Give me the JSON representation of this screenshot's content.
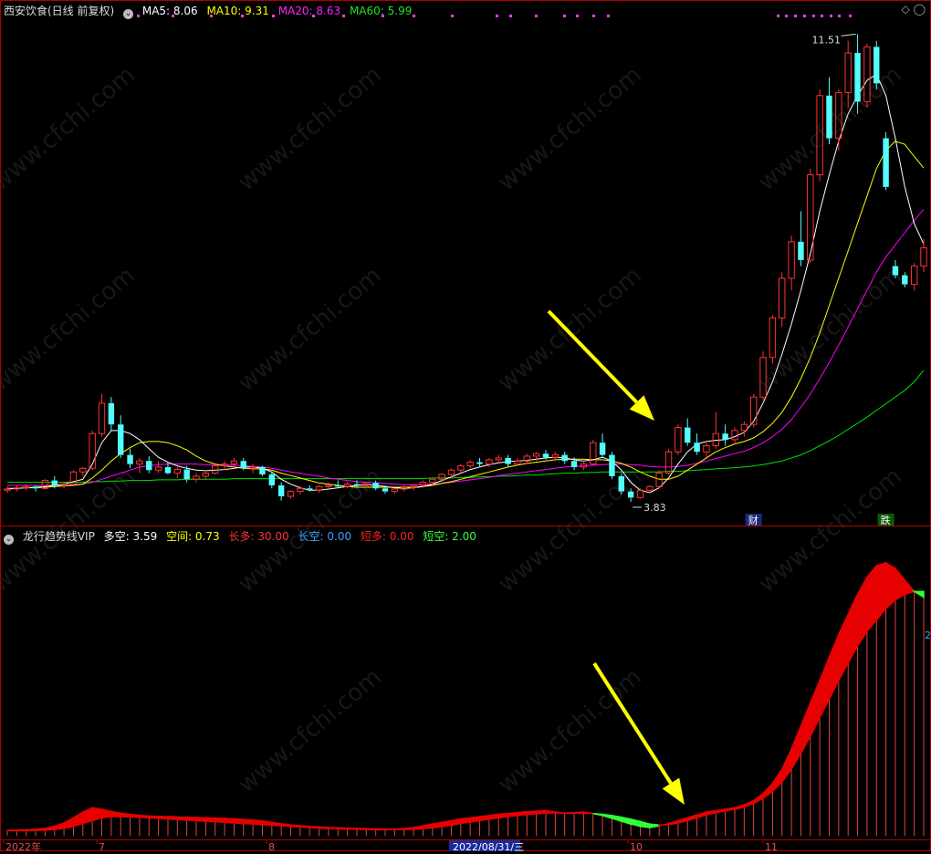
{
  "colors": {
    "up": "#ff3232",
    "down": "#54fcfc",
    "ma5": "#ffffff",
    "ma10": "#ffff00",
    "ma20": "#ff00ff",
    "ma60": "#00e000",
    "bull": "#e60000",
    "bear": "#33ff33",
    "arrow": "#ffff00"
  },
  "top_header": {
    "title": "西安饮食(日线 前复权)",
    "ma5": "MA5: 8.06",
    "ma10": "MA10: 9.31",
    "ma20": "MA20: 8.63",
    "ma60": "MA60: 5.99"
  },
  "bottom_header": {
    "title": "龙行趋势线VIP",
    "duokong": "多空: 3.59",
    "kongjian": "空间: 0.73",
    "changduo": "长多: 30.00",
    "changkong": "长空: 0.00",
    "duanduo": "短多: 0.00",
    "duankong": "短空: 2.00"
  },
  "annotations": {
    "high_label": "11.51",
    "low_label": "3.83",
    "cai_badge": "财",
    "die_badge": "跌",
    "side_value": "2"
  },
  "watermark": "www.cfchi.com",
  "x_axis": {
    "labels": [
      "2022年",
      "7",
      "8",
      "2022/08/31/三",
      "10",
      "11"
    ]
  },
  "chart_data": {
    "type": "candlestick",
    "title": "西安饮食(日线 前复权)",
    "y_range": [
      3.5,
      11.8
    ],
    "candles": [
      [
        4.02,
        4.08,
        3.98,
        4.04
      ],
      [
        4.04,
        4.1,
        4.0,
        4.06
      ],
      [
        4.06,
        4.12,
        4.02,
        4.08
      ],
      [
        4.08,
        4.1,
        4.0,
        4.05
      ],
      [
        4.05,
        4.2,
        4.03,
        4.18
      ],
      [
        4.18,
        4.25,
        4.05,
        4.1
      ],
      [
        4.1,
        4.16,
        4.05,
        4.12
      ],
      [
        4.12,
        4.35,
        4.1,
        4.32
      ],
      [
        4.32,
        4.4,
        4.25,
        4.38
      ],
      [
        4.38,
        5.0,
        4.35,
        4.95
      ],
      [
        4.95,
        5.6,
        4.9,
        5.45
      ],
      [
        5.45,
        5.55,
        5.0,
        5.1
      ],
      [
        5.1,
        5.25,
        4.55,
        4.6
      ],
      [
        4.6,
        4.7,
        4.38,
        4.45
      ],
      [
        4.45,
        4.55,
        4.3,
        4.5
      ],
      [
        4.5,
        4.58,
        4.3,
        4.35
      ],
      [
        4.35,
        4.5,
        4.3,
        4.4
      ],
      [
        4.4,
        4.48,
        4.28,
        4.3
      ],
      [
        4.3,
        4.4,
        4.22,
        4.36
      ],
      [
        4.36,
        4.42,
        4.15,
        4.2
      ],
      [
        4.2,
        4.3,
        4.15,
        4.25
      ],
      [
        4.25,
        4.35,
        4.2,
        4.3
      ],
      [
        4.3,
        4.45,
        4.28,
        4.42
      ],
      [
        4.42,
        4.5,
        4.35,
        4.45
      ],
      [
        4.45,
        4.55,
        4.38,
        4.5
      ],
      [
        4.5,
        4.55,
        4.35,
        4.38
      ],
      [
        4.38,
        4.45,
        4.3,
        4.4
      ],
      [
        4.4,
        4.42,
        4.25,
        4.28
      ],
      [
        4.28,
        4.32,
        4.05,
        4.1
      ],
      [
        4.1,
        4.15,
        3.85,
        3.92
      ],
      [
        3.92,
        4.02,
        3.88,
        4.0
      ],
      [
        4.0,
        4.08,
        3.95,
        4.05
      ],
      [
        4.05,
        4.1,
        4.0,
        4.02
      ],
      [
        4.02,
        4.1,
        3.98,
        4.08
      ],
      [
        4.08,
        4.15,
        4.04,
        4.1
      ],
      [
        4.1,
        4.18,
        4.05,
        4.08
      ],
      [
        4.08,
        4.16,
        4.05,
        4.12
      ],
      [
        4.12,
        4.18,
        4.06,
        4.1
      ],
      [
        4.1,
        4.16,
        4.05,
        4.14
      ],
      [
        4.14,
        4.18,
        4.02,
        4.05
      ],
      [
        4.05,
        4.1,
        3.96,
        4.0
      ],
      [
        4.0,
        4.06,
        3.96,
        4.04
      ],
      [
        4.04,
        4.1,
        4.0,
        4.06
      ],
      [
        4.06,
        4.12,
        4.02,
        4.1
      ],
      [
        4.1,
        4.18,
        4.06,
        4.15
      ],
      [
        4.15,
        4.22,
        4.1,
        4.2
      ],
      [
        4.2,
        4.3,
        4.15,
        4.28
      ],
      [
        4.28,
        4.38,
        4.22,
        4.35
      ],
      [
        4.35,
        4.45,
        4.3,
        4.42
      ],
      [
        4.42,
        4.52,
        4.38,
        4.48
      ],
      [
        4.48,
        4.55,
        4.4,
        4.45
      ],
      [
        4.45,
        4.55,
        4.4,
        4.52
      ],
      [
        4.52,
        4.6,
        4.45,
        4.55
      ],
      [
        4.55,
        4.6,
        4.4,
        4.45
      ],
      [
        4.45,
        4.55,
        4.42,
        4.5
      ],
      [
        4.5,
        4.62,
        4.45,
        4.58
      ],
      [
        4.58,
        4.65,
        4.5,
        4.62
      ],
      [
        4.62,
        4.68,
        4.52,
        4.56
      ],
      [
        4.56,
        4.65,
        4.5,
        4.6
      ],
      [
        4.6,
        4.65,
        4.45,
        4.5
      ],
      [
        4.5,
        4.56,
        4.35,
        4.4
      ],
      [
        4.4,
        4.48,
        4.35,
        4.45
      ],
      [
        4.45,
        4.85,
        4.42,
        4.8
      ],
      [
        4.8,
        4.95,
        4.55,
        4.6
      ],
      [
        4.6,
        4.65,
        4.2,
        4.25
      ],
      [
        4.25,
        4.3,
        3.95,
        4.0
      ],
      [
        4.0,
        4.05,
        3.83,
        3.9
      ],
      [
        3.9,
        4.05,
        3.88,
        4.02
      ],
      [
        4.02,
        4.1,
        3.98,
        4.08
      ],
      [
        4.08,
        4.35,
        4.05,
        4.3
      ],
      [
        4.3,
        4.7,
        4.28,
        4.65
      ],
      [
        4.65,
        5.1,
        4.6,
        5.05
      ],
      [
        5.05,
        5.2,
        4.75,
        4.8
      ],
      [
        4.8,
        4.95,
        4.6,
        4.65
      ],
      [
        4.65,
        4.8,
        4.55,
        4.75
      ],
      [
        4.75,
        5.3,
        4.7,
        4.95
      ],
      [
        4.95,
        5.1,
        4.75,
        4.85
      ],
      [
        4.85,
        5.05,
        4.78,
        5.0
      ],
      [
        5.0,
        5.15,
        4.9,
        5.1
      ],
      [
        5.1,
        5.6,
        5.05,
        5.55
      ],
      [
        5.55,
        6.3,
        5.5,
        6.2
      ],
      [
        6.2,
        6.9,
        6.1,
        6.85
      ],
      [
        6.85,
        7.6,
        6.7,
        7.5
      ],
      [
        7.5,
        8.2,
        7.3,
        8.1
      ],
      [
        8.1,
        8.6,
        7.7,
        7.8
      ],
      [
        7.8,
        9.3,
        7.75,
        9.2
      ],
      [
        9.2,
        10.6,
        9.1,
        10.5
      ],
      [
        10.5,
        10.8,
        9.7,
        9.8
      ],
      [
        9.8,
        10.6,
        9.6,
        10.55
      ],
      [
        10.55,
        11.4,
        10.3,
        11.2
      ],
      [
        11.2,
        11.51,
        10.2,
        10.4
      ],
      [
        10.4,
        11.35,
        10.3,
        11.3
      ],
      [
        11.3,
        11.4,
        10.6,
        10.7
      ],
      [
        9.8,
        9.9,
        8.95,
        9.0
      ],
      [
        7.7,
        7.8,
        7.5,
        7.55
      ],
      [
        7.55,
        7.6,
        7.35,
        7.4
      ],
      [
        7.4,
        7.75,
        7.3,
        7.7
      ],
      [
        7.7,
        8.15,
        7.6,
        8.0
      ]
    ],
    "ma5": [
      4.04,
      4.05,
      4.06,
      4.07,
      4.08,
      4.1,
      4.12,
      4.16,
      4.2,
      4.45,
      4.8,
      5.0,
      5.0,
      4.95,
      4.85,
      4.7,
      4.56,
      4.48,
      4.42,
      4.38,
      4.35,
      4.34,
      4.35,
      4.36,
      4.38,
      4.4,
      4.4,
      4.38,
      4.32,
      4.2,
      4.12,
      4.06,
      4.02,
      4.02,
      4.04,
      4.06,
      4.08,
      4.1,
      4.11,
      4.1,
      4.08,
      4.06,
      4.05,
      4.06,
      4.08,
      4.12,
      4.18,
      4.24,
      4.3,
      4.36,
      4.4,
      4.44,
      4.47,
      4.49,
      4.5,
      4.51,
      4.53,
      4.55,
      4.56,
      4.55,
      4.52,
      4.5,
      4.52,
      4.56,
      4.5,
      4.35,
      4.15,
      4.02,
      3.98,
      4.06,
      4.22,
      4.45,
      4.65,
      4.78,
      4.82,
      4.84,
      4.85,
      4.9,
      4.97,
      5.15,
      5.45,
      5.8,
      6.25,
      6.75,
      7.3,
      7.9,
      8.6,
      9.2,
      9.75,
      10.2,
      10.5,
      10.75,
      10.85,
      10.5,
      9.8,
      9.0,
      8.4,
      8.06
    ],
    "ma10": [
      4.05,
      4.05,
      4.06,
      4.06,
      4.07,
      4.08,
      4.09,
      4.1,
      4.12,
      4.22,
      4.35,
      4.5,
      4.62,
      4.72,
      4.8,
      4.82,
      4.82,
      4.8,
      4.75,
      4.68,
      4.58,
      4.5,
      4.45,
      4.42,
      4.4,
      4.38,
      4.37,
      4.37,
      4.35,
      4.3,
      4.26,
      4.22,
      4.18,
      4.14,
      4.12,
      4.1,
      4.08,
      4.07,
      4.07,
      4.07,
      4.07,
      4.07,
      4.07,
      4.07,
      4.08,
      4.1,
      4.13,
      4.16,
      4.2,
      4.24,
      4.28,
      4.32,
      4.36,
      4.4,
      4.43,
      4.46,
      4.48,
      4.5,
      4.52,
      4.53,
      4.53,
      4.53,
      4.52,
      4.52,
      4.5,
      4.46,
      4.4,
      4.32,
      4.25,
      4.2,
      4.2,
      4.25,
      4.35,
      4.45,
      4.55,
      4.65,
      4.72,
      4.78,
      4.82,
      4.88,
      4.98,
      5.12,
      5.3,
      5.55,
      5.85,
      6.2,
      6.6,
      7.05,
      7.5,
      7.95,
      8.4,
      8.85,
      9.3,
      9.6,
      9.75,
      9.7,
      9.5,
      9.31
    ],
    "ma20": [
      4.1,
      4.1,
      4.1,
      4.1,
      4.1,
      4.1,
      4.1,
      4.11,
      4.12,
      4.15,
      4.2,
      4.25,
      4.3,
      4.35,
      4.4,
      4.42,
      4.44,
      4.45,
      4.45,
      4.45,
      4.45,
      4.44,
      4.44,
      4.43,
      4.43,
      4.42,
      4.41,
      4.4,
      4.38,
      4.35,
      4.32,
      4.3,
      4.27,
      4.25,
      4.22,
      4.2,
      4.18,
      4.16,
      4.15,
      4.14,
      4.13,
      4.12,
      4.11,
      4.11,
      4.11,
      4.12,
      4.13,
      4.15,
      4.17,
      4.19,
      4.21,
      4.23,
      4.26,
      4.28,
      4.3,
      4.32,
      4.34,
      4.36,
      4.38,
      4.4,
      4.41,
      4.42,
      4.43,
      4.44,
      4.45,
      4.45,
      4.44,
      4.43,
      4.41,
      4.4,
      4.4,
      4.41,
      4.43,
      4.46,
      4.5,
      4.54,
      4.58,
      4.62,
      4.66,
      4.72,
      4.8,
      4.9,
      5.02,
      5.18,
      5.38,
      5.6,
      5.85,
      6.12,
      6.4,
      6.7,
      7.0,
      7.3,
      7.6,
      7.85,
      8.05,
      8.25,
      8.45,
      8.63
    ],
    "ma60": [
      4.15,
      4.15,
      4.15,
      4.15,
      4.15,
      4.15,
      4.15,
      4.15,
      4.15,
      4.16,
      4.16,
      4.17,
      4.17,
      4.18,
      4.18,
      4.18,
      4.19,
      4.19,
      4.19,
      4.2,
      4.2,
      4.2,
      4.2,
      4.2,
      4.21,
      4.21,
      4.21,
      4.21,
      4.21,
      4.21,
      4.21,
      4.21,
      4.21,
      4.21,
      4.21,
      4.21,
      4.21,
      4.21,
      4.21,
      4.21,
      4.21,
      4.21,
      4.21,
      4.21,
      4.21,
      4.22,
      4.22,
      4.22,
      4.23,
      4.23,
      4.24,
      4.24,
      4.25,
      4.25,
      4.26,
      4.27,
      4.27,
      4.28,
      4.29,
      4.3,
      4.3,
      4.31,
      4.31,
      4.32,
      4.32,
      4.32,
      4.32,
      4.32,
      4.32,
      4.32,
      4.33,
      4.33,
      4.34,
      4.35,
      4.36,
      4.37,
      4.38,
      4.39,
      4.4,
      4.42,
      4.44,
      4.47,
      4.5,
      4.55,
      4.6,
      4.67,
      4.75,
      4.83,
      4.92,
      5.02,
      5.12,
      5.22,
      5.33,
      5.44,
      5.55,
      5.66,
      5.8,
      5.99
    ],
    "indicator": {
      "name": "龙行趋势线VIP",
      "y_range": [
        0,
        100
      ],
      "upper": [
        0.6,
        0.7,
        0.8,
        1.0,
        1.3,
        2.0,
        3.2,
        5.0,
        7.0,
        8.5,
        8.0,
        7.2,
        6.6,
        6.2,
        5.8,
        5.6,
        5.5,
        5.4,
        5.3,
        5.2,
        5.1,
        5.0,
        4.9,
        4.8,
        4.6,
        4.4,
        4.2,
        3.9,
        3.4,
        2.9,
        2.5,
        2.2,
        2.0,
        1.8,
        1.6,
        1.5,
        1.4,
        1.3,
        1.2,
        1.1,
        1.0,
        1.0,
        1.2,
        1.6,
        2.2,
        2.8,
        3.4,
        4.0,
        4.6,
        5.0,
        5.4,
        5.8,
        6.2,
        6.5,
        6.8,
        7.1,
        7.3,
        7.5,
        7.0,
        6.6,
        6.8,
        7.0,
        6.5,
        5.8,
        4.8,
        3.8,
        2.8,
        2.0,
        1.6,
        2.2,
        3.0,
        4.0,
        5.0,
        6.0,
        7.0,
        7.5,
        8.0,
        8.5,
        9.5,
        11.0,
        13.5,
        17.0,
        22.0,
        29.0,
        37.0,
        45.0,
        53.0,
        61.0,
        69.0,
        76.0,
        83.0,
        89.0,
        93.0,
        94.0,
        92.0,
        88.0,
        84.0,
        82.0
      ],
      "lower": [
        0.5,
        0.5,
        0.5,
        0.6,
        0.7,
        0.9,
        1.3,
        2.0,
        3.0,
        4.0,
        5.0,
        5.4,
        5.4,
        5.3,
        5.2,
        5.0,
        4.8,
        4.6,
        4.4,
        4.2,
        4.0,
        3.8,
        3.6,
        3.4,
        3.2,
        3.0,
        2.8,
        2.6,
        2.4,
        2.2,
        2.0,
        1.8,
        1.6,
        1.4,
        1.3,
        1.2,
        1.1,
        1.0,
        0.9,
        0.8,
        0.8,
        0.9,
        0.9,
        1.0,
        1.2,
        1.5,
        1.9,
        2.4,
        3.0,
        3.5,
        4.0,
        4.5,
        5.0,
        5.4,
        5.8,
        6.1,
        6.4,
        6.6,
        6.7,
        6.6,
        6.6,
        6.6,
        6.5,
        6.2,
        5.8,
        5.2,
        4.5,
        3.7,
        2.8,
        2.5,
        2.6,
        3.2,
        4.0,
        5.0,
        6.0,
        6.8,
        7.4,
        8.0,
        8.8,
        10.0,
        11.8,
        14.2,
        17.5,
        22.0,
        27.5,
        33.5,
        40.0,
        46.5,
        53.0,
        59.0,
        65.0,
        70.0,
        74.0,
        78.0,
        81.0,
        83.0,
        84.0,
        84.0
      ]
    }
  }
}
